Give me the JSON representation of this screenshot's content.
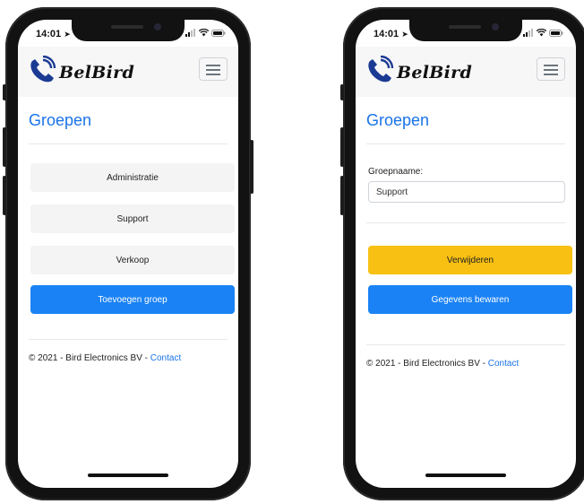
{
  "status": {
    "time": "14:01"
  },
  "brand": {
    "name": "BelBird"
  },
  "left_screen": {
    "title": "Groepen",
    "groups": [
      "Administratie",
      "Support",
      "Verkoop"
    ],
    "add_button": "Toevoegen groep"
  },
  "right_screen": {
    "title": "Groepen",
    "field_label": "Groepnaame:",
    "field_value": "Support",
    "delete_button": "Verwijderen",
    "save_button": "Gegevens bewaren"
  },
  "footer": {
    "text": "© 2021 - Bird Electronics BV - ",
    "link": "Contact"
  },
  "colors": {
    "primary": "#1a82f5",
    "warning": "#f7c012",
    "title": "#1a73e8"
  },
  "icons": [
    "location-arrow-icon",
    "signal-icon",
    "wifi-icon",
    "battery-icon",
    "phone-logo-icon",
    "menu-icon"
  ]
}
